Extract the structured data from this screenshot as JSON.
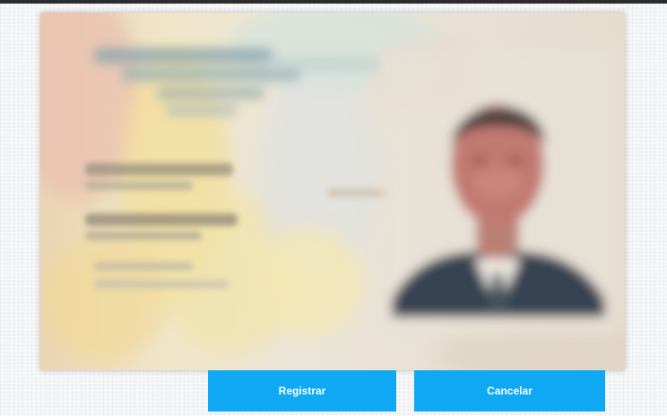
{
  "document_image": {
    "description_icon": "id-card-photo-icon",
    "colors": {
      "card_base": "#e7ddc9",
      "accent_yellow": "#f0d67a",
      "accent_blue": "#9fc6d8",
      "suit": "#1f2a3a",
      "face": "#b9685e"
    }
  },
  "actions": {
    "register_label": "Registrar",
    "cancel_label": "Cancelar"
  },
  "colors": {
    "button_bg": "#0ea9f2",
    "button_text": "#ffffff",
    "page_bg": "#f3f4f5"
  }
}
